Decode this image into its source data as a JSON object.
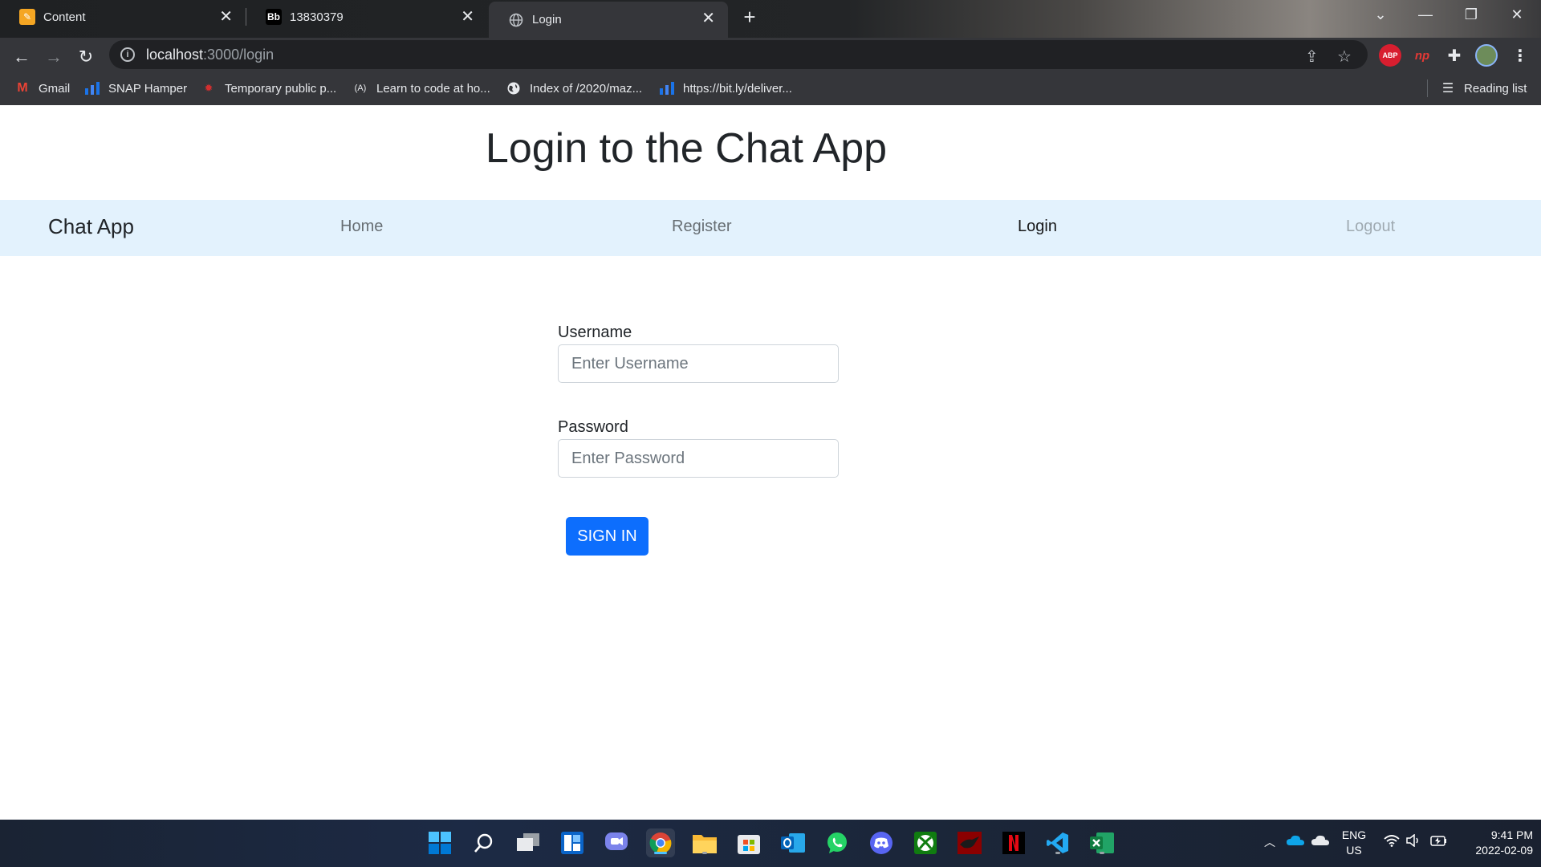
{
  "browser": {
    "tabs": [
      {
        "title": "Content",
        "icon": "pencil-note-icon",
        "active": false
      },
      {
        "title": "13830379",
        "icon": "blackboard-bb-icon",
        "active": false
      },
      {
        "title": "Login",
        "icon": "globe-icon",
        "active": true
      }
    ],
    "favicon_bb_text": "Bb",
    "url_host": "localhost",
    "url_path": ":3000/login",
    "extensions": {
      "abp_text": "ABP",
      "np_text": "np"
    },
    "bookmarks": [
      {
        "label": "Gmail",
        "icon": "gmail-icon"
      },
      {
        "label": "SNAP Hamper",
        "icon": "bar-chart-icon"
      },
      {
        "label": "Temporary public p...",
        "icon": "maple-leaf-icon"
      },
      {
        "label": "Learn to code at ho...",
        "icon": "code-academy-icon"
      },
      {
        "label": "Index of /2020/maz...",
        "icon": "globe-icon"
      },
      {
        "label": "https://bit.ly/deliver...",
        "icon": "bar-chart-icon"
      }
    ],
    "reading_list": "Reading list"
  },
  "page": {
    "title": "Login to the Chat App",
    "navbar": {
      "brand": "Chat App",
      "links": [
        "Home",
        "Register",
        "Login",
        "Logout"
      ],
      "active": "Login",
      "disabled": "Logout"
    },
    "form": {
      "username_label": "Username",
      "username_placeholder": "Enter Username",
      "password_label": "Password",
      "password_placeholder": "Enter Password",
      "submit_label": "Sign in"
    }
  },
  "taskbar": {
    "apps": [
      "windows-start-icon",
      "search-icon",
      "task-view-icon",
      "widgets-icon",
      "teams-chat-icon",
      "chrome-icon",
      "file-explorer-icon",
      "microsoft-store-icon",
      "outlook-icon",
      "whatsapp-icon",
      "discord-icon",
      "xbox-icon",
      "game-app-icon",
      "netflix-icon",
      "vscode-icon",
      "excel-icon"
    ],
    "language": "ENG",
    "region": "US",
    "time": "9:41 PM",
    "date": "2022-02-09"
  },
  "colors": {
    "primary": "#0d6efd",
    "navbar_bg": "#e3f2fd",
    "chrome_dark": "#35363a"
  }
}
